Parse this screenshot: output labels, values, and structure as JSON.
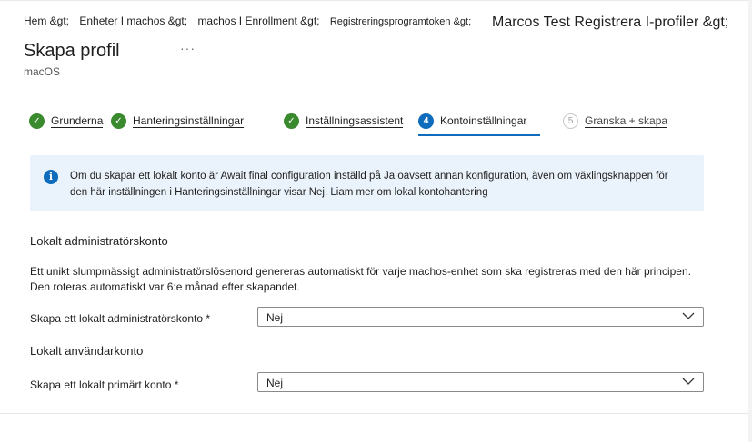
{
  "breadcrumb": {
    "items": [
      "Hem &gt;",
      "Enheter I machos &gt;",
      "machos I Enrollment &gt;",
      "Registreringsprogramtoken &gt;"
    ],
    "tail": "Marcos Test Registrera I-profiler &gt;"
  },
  "page": {
    "title": "Skapa profil",
    "ellipsis": "···",
    "subtitle": "macOS"
  },
  "steps": [
    {
      "number": "✓",
      "label": "Grunderna",
      "state": "done"
    },
    {
      "number": "✓",
      "label": "Hanteringsinställningar",
      "state": "done"
    },
    {
      "number": "✓",
      "label": "Inställningsassistent",
      "state": "done"
    },
    {
      "number": "4",
      "label": "Kontoinställningar",
      "state": "active"
    },
    {
      "number": "5",
      "label": "Granska + skapa",
      "state": "todo"
    }
  ],
  "info": {
    "icon": "info-icon",
    "line1": "Om du skapar ett lokalt konto är Await final configuration inställd på Ja oavsett annan konfiguration, även om växlingsknappen för",
    "line2": "den här inställningen i Hanteringsinställningar visar Nej. Liam mer om lokal kontohantering"
  },
  "admin_section": {
    "heading": "Lokalt administratörskonto",
    "para_line1": "Ett unikt slumpmässigt administratörslösenord genereras automatiskt för varje machos-enhet som ska registreras med den här principen.",
    "para_line2": "Den roteras automatiskt var 6:e månad efter skapandet.",
    "field_label": "Skapa ett lokalt administratörskonto *",
    "field_value": "Nej"
  },
  "user_section": {
    "heading": "Lokalt användarkonto",
    "field_label": "Skapa ett lokalt primärt konto *",
    "field_value": "Nej"
  },
  "colors": {
    "accent": "#0f6cbd",
    "done": "#3a8a2e",
    "info_bg": "#eaf3fb"
  }
}
